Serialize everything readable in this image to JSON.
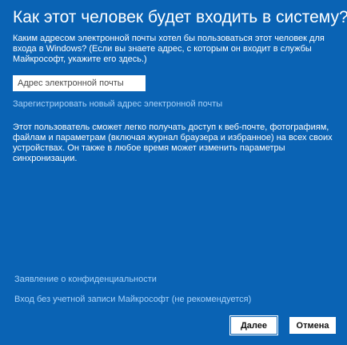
{
  "colors": {
    "background": "#0a63b4",
    "link": "#a9d3fa",
    "text": "#ffffff"
  },
  "header": {
    "title": "Как этот человек будет входить в систему?"
  },
  "prompt": {
    "text": "Каким адресом электронной почты хотел бы пользоваться этот человек для входа в Windows? (Если вы знаете адрес, с которым он входит в службы Майкрософт, укажите его здесь.)"
  },
  "email": {
    "value": "",
    "placeholder": "Адрес электронной почты"
  },
  "links": {
    "register": "Зарегистрировать новый адрес электронной почты",
    "privacy": "Заявление о конфиденциальности",
    "no_account": "Вход без учетной записи Майкрософт (не рекомендуется)"
  },
  "info": {
    "text": "Этот пользователь сможет легко получать доступ к веб-почте, фотографиям, файлам и параметрам (включая журнал браузера и избранное) на всех своих устройствах. Он также в любое время может изменить параметры синхронизации."
  },
  "buttons": {
    "next": "Далее",
    "cancel": "Отмена"
  }
}
